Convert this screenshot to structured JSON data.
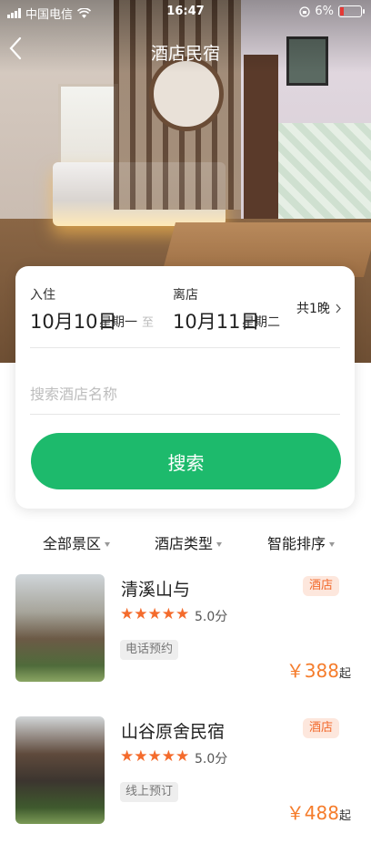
{
  "status_bar": {
    "carrier": "中国电信",
    "time": "16:47",
    "battery": "6%"
  },
  "nav": {
    "title": "酒店民宿"
  },
  "search": {
    "checkin_label": "入住",
    "checkin_date": "10月10日",
    "checkin_weekday": "星期一",
    "to_text": "至",
    "checkout_label": "离店",
    "checkout_date": "10月11日",
    "checkout_weekday": "星期二",
    "nights": "共1晚",
    "placeholder": "搜索酒店名称",
    "button": "搜索"
  },
  "filters": [
    "全部景区",
    "酒店类型",
    "智能排序"
  ],
  "hotels": [
    {
      "name": "清溪山与",
      "tag": "酒店",
      "stars": "★★★★★",
      "score": "5.0分",
      "booking": "电话预约",
      "price": "￥388",
      "price_suffix": "起"
    },
    {
      "name": "山谷原舍民宿",
      "tag": "酒店",
      "stars": "★★★★★",
      "score": "5.0分",
      "booking": "线上预订",
      "price": "￥488",
      "price_suffix": "起"
    }
  ],
  "colors": {
    "accent": "#1dba6c",
    "price": "#f57c2b",
    "star": "#f46b2c"
  }
}
